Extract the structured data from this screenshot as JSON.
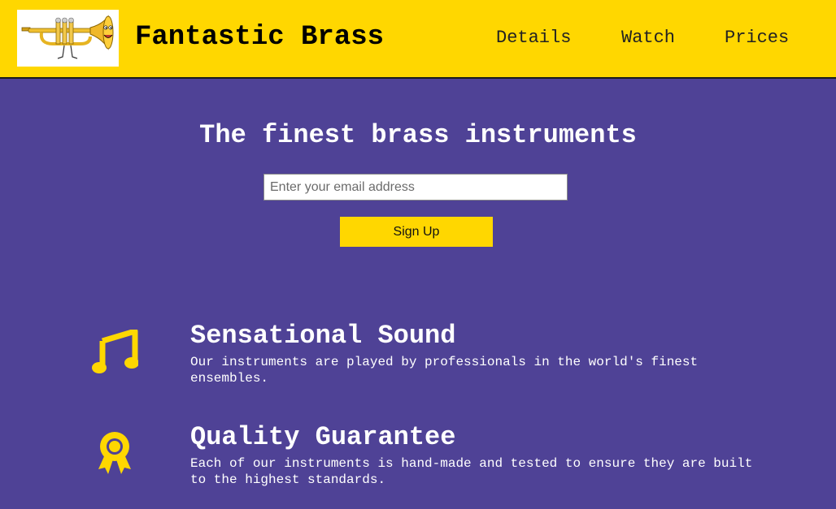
{
  "header": {
    "logo_icon": "trumpet-logo-icon",
    "brand": "Fantastic Brass",
    "nav": [
      {
        "label": "Details"
      },
      {
        "label": "Watch"
      },
      {
        "label": "Prices"
      }
    ]
  },
  "hero": {
    "title": "The finest brass instruments",
    "email_placeholder": "Enter your email address",
    "signup_label": "Sign Up"
  },
  "features": [
    {
      "icon": "music-note-icon",
      "title": "Sensational Sound",
      "text": "Our instruments are played by professionals in the world's finest ensembles."
    },
    {
      "icon": "award-ribbon-icon",
      "title": "Quality Guarantee",
      "text": "Each of our instruments is hand-made and tested to ensure they are built to the highest standards."
    }
  ],
  "colors": {
    "header_bg": "#ffd700",
    "body_bg": "#4f4296",
    "accent": "#ffd700",
    "text_light": "#ffffff"
  }
}
